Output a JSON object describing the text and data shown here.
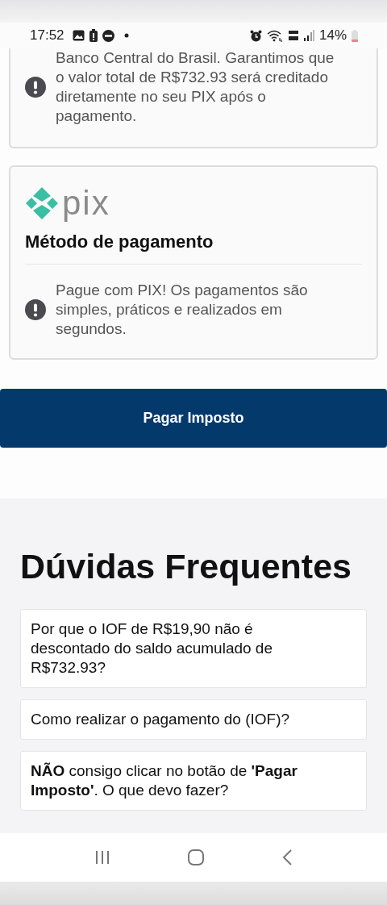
{
  "status_bar": {
    "time": "17:52",
    "battery": "14%"
  },
  "notice_card": {
    "text": "Banco Central do Brasil. Garantimos que o valor total de R$732.93 será creditado diretamente no seu PIX após o pagamento."
  },
  "payment_card": {
    "logo_text": "pix",
    "title": "Método de pagamento",
    "info": "Pague com PIX! Os pagamentos são simples, práticos e realizados em segundos."
  },
  "pay_button": "Pagar Imposto",
  "faq": {
    "title": "Dúvidas Frequentes",
    "items": [
      {
        "question": "Por que o IOF de R$19,90 não é descontado do saldo acumulado de R$732.93?",
        "expanded": false
      },
      {
        "question": "Como realizar o pagamento do (IOF)?",
        "expanded": false
      },
      {
        "question": "**NÃO** consigo clicar no botão de **'Pagar Imposto'**. O que devo fazer?",
        "expanded": false
      }
    ]
  }
}
